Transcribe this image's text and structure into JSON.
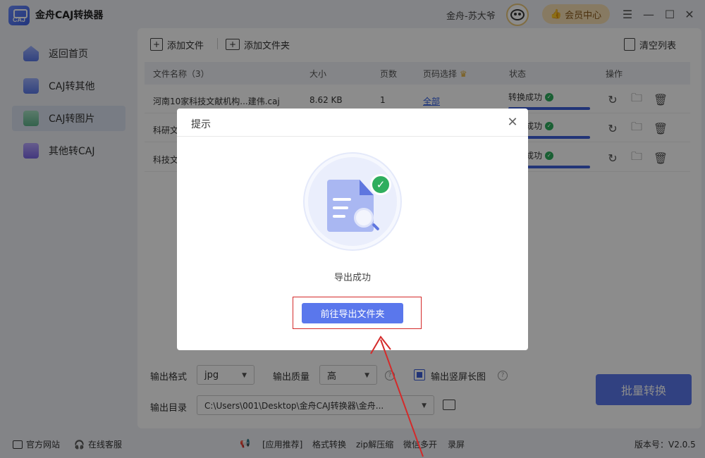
{
  "app": {
    "title": "金舟CAJ转换器",
    "logo_text": "CAJ",
    "user_name": "金舟-苏大爷",
    "vip_label": "会员中心"
  },
  "sidebar": {
    "items": [
      {
        "label": "返回首页",
        "icon": "home-icon"
      },
      {
        "label": "CAJ转其他",
        "icon": "document-icon"
      },
      {
        "label": "CAJ转图片",
        "icon": "image-icon",
        "active": true
      },
      {
        "label": "其他转CAJ",
        "icon": "caj-icon"
      }
    ]
  },
  "toolbar": {
    "add_file": "添加文件",
    "add_folder": "添加文件夹",
    "clear_list": "清空列表"
  },
  "table": {
    "headers": {
      "name": "文件名称（3）",
      "size": "大小",
      "pages": "页数",
      "page_select": "页码选择",
      "status": "状态",
      "actions": "操作"
    },
    "rows": [
      {
        "name": "河南10家科技文献机构...建伟.caj",
        "size": "8.62 KB",
        "pages": "1",
        "page_select": "全部",
        "status": "转换成功"
      },
      {
        "name": "科研文",
        "status": "转换成功"
      },
      {
        "name": "科技文",
        "status": "转换成功"
      }
    ]
  },
  "options": {
    "format_label": "输出格式",
    "format_value": "jpg",
    "quality_label": "输出质量",
    "quality_value": "高",
    "long_image_label": "输出竖屏长图",
    "dir_label": "输出目录",
    "dir_value": "C:\\Users\\001\\Desktop\\金舟CAJ转换器\\金舟...",
    "batch_button": "批量转换"
  },
  "modal": {
    "title": "提示",
    "message": "导出成功",
    "open_folder_button": "前往导出文件夹"
  },
  "footer": {
    "official_site": "官方网站",
    "online_service": "在线客服",
    "app_recommend": "[应用推荐]",
    "format_convert": "格式转换",
    "zip": "zip解压缩",
    "wechat_multi": "微信多开",
    "screen_record": "录屏",
    "version": "版本号：V2.0.5"
  },
  "colors": {
    "accent": "#5a77ec",
    "success": "#2fae5e",
    "highlight": "#d42a2a"
  }
}
